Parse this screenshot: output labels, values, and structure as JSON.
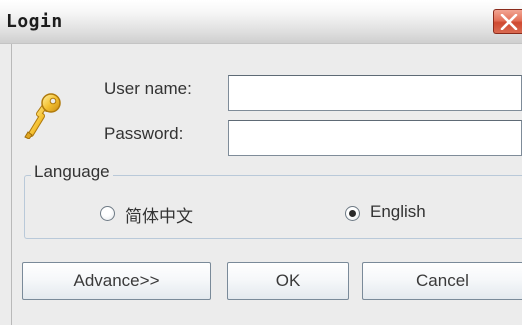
{
  "window": {
    "title": "Login",
    "close_icon": "close-icon",
    "close_color": "#d9563c"
  },
  "form": {
    "key_icon": "key-icon",
    "username_label": "User name:",
    "username_value": "",
    "password_label": "Password:",
    "password_value": ""
  },
  "language": {
    "legend": "Language",
    "options": [
      {
        "label": "简体中文",
        "selected": false
      },
      {
        "label": "English",
        "selected": true
      }
    ]
  },
  "buttons": {
    "advance": "Advance>>",
    "ok": "OK",
    "cancel": "Cancel"
  }
}
